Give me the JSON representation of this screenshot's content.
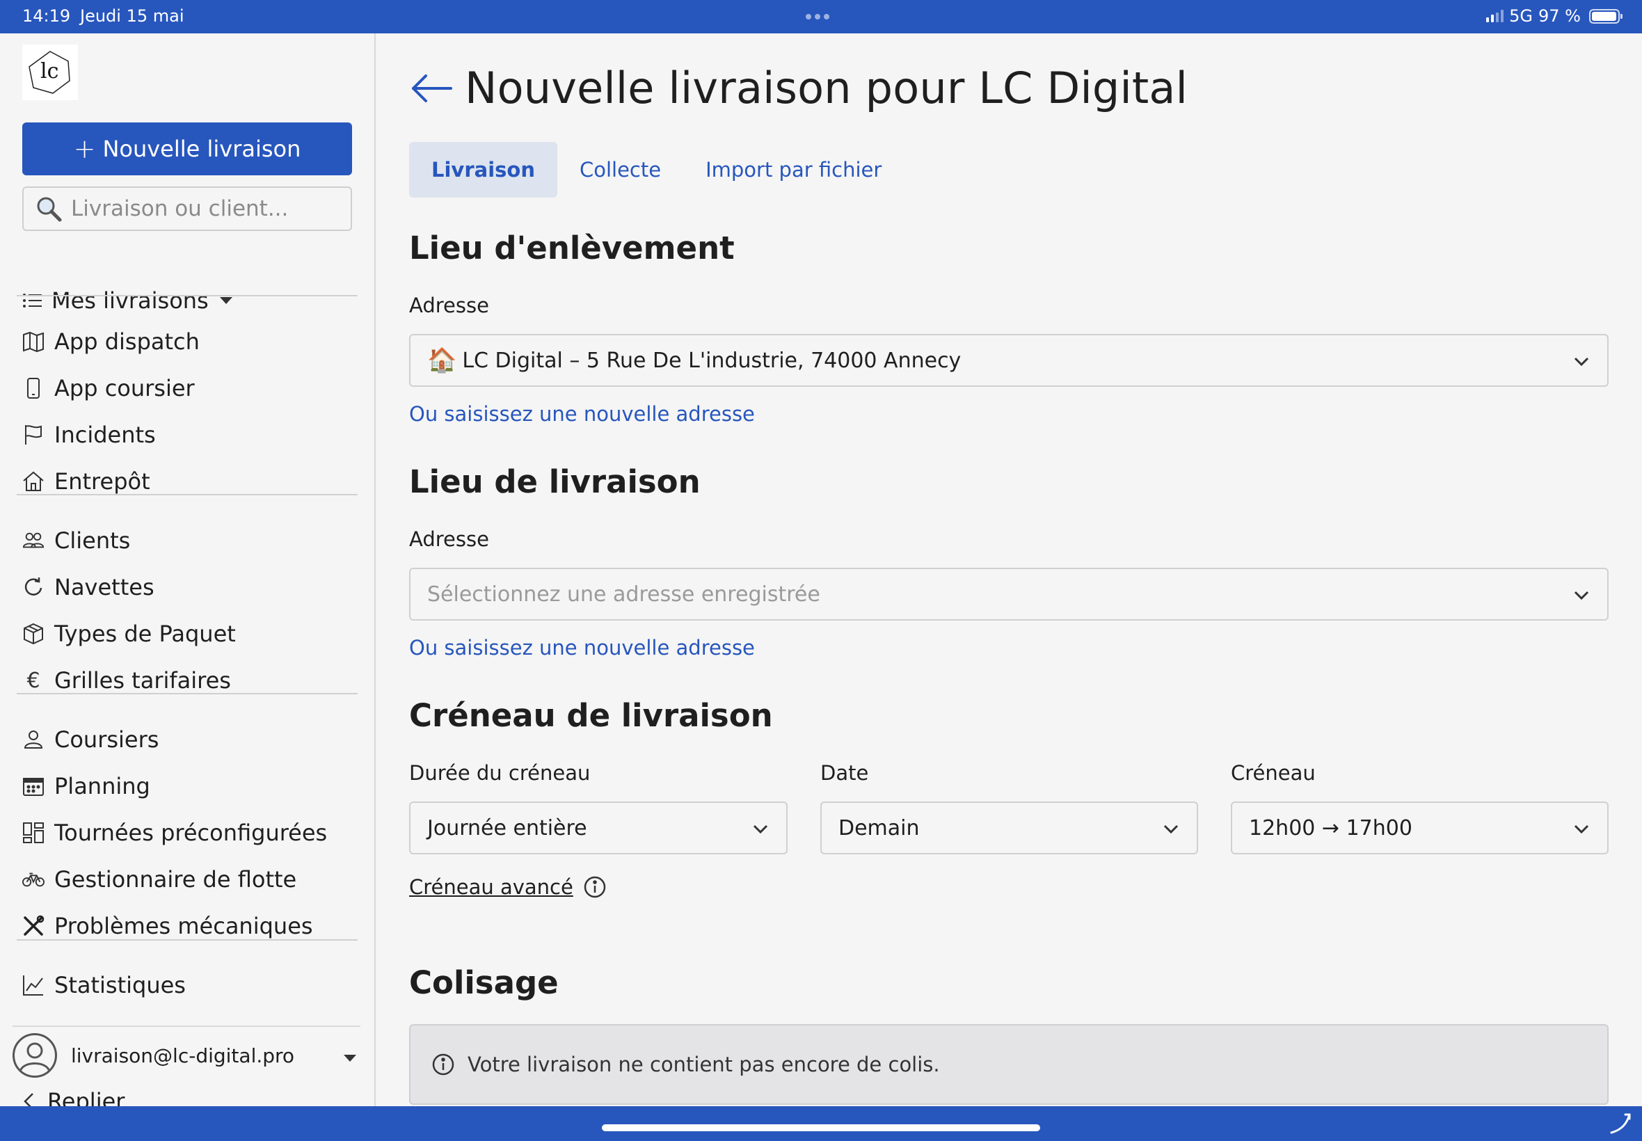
{
  "status_bar": {
    "time": "14:19",
    "date": "Jeudi 15 mai",
    "network": "5G",
    "battery": "97 %",
    "battery_level": 0.97
  },
  "sidebar": {
    "new_delivery_label": "Nouvelle livraison",
    "search_placeholder": "Livraison ou client...",
    "my_deliveries_label": "Mes livraisons",
    "groups": [
      [
        {
          "label": "App dispatch",
          "icon": "map-icon"
        },
        {
          "label": "App coursier",
          "icon": "phone-icon"
        },
        {
          "label": "Incidents",
          "icon": "flag-icon"
        },
        {
          "label": "Entrepôt",
          "icon": "house-icon"
        }
      ],
      [
        {
          "label": "Clients",
          "icon": "users-icon"
        },
        {
          "label": "Navettes",
          "icon": "refresh-icon"
        },
        {
          "label": "Types de Paquet",
          "icon": "box-icon"
        },
        {
          "label": "Grilles tarifaires",
          "icon": "euro-icon"
        }
      ],
      [
        {
          "label": "Coursiers",
          "icon": "person-icon"
        },
        {
          "label": "Planning",
          "icon": "calendar-icon"
        },
        {
          "label": "Tournées préconfigurées",
          "icon": "layout-icon"
        },
        {
          "label": "Gestionnaire de flotte",
          "icon": "bicycle-icon"
        },
        {
          "label": "Problèmes mécaniques",
          "icon": "tools-icon"
        }
      ],
      [
        {
          "label": "Statistiques",
          "icon": "chart-icon"
        }
      ]
    ],
    "user_email": "livraison@lc-digital.pro",
    "collapse_label": "Replier"
  },
  "main": {
    "title": "Nouvelle livraison pour LC Digital",
    "tabs": [
      {
        "label": "Livraison",
        "active": true
      },
      {
        "label": "Collecte",
        "active": false
      },
      {
        "label": "Import par fichier",
        "active": false
      }
    ],
    "pickup": {
      "title": "Lieu d'enlèvement",
      "address_label": "Adresse",
      "address_value": "LC Digital – 5 Rue De L'industrie, 74000 Annecy",
      "new_address_link": "Ou saisissez une nouvelle adresse"
    },
    "delivery": {
      "title": "Lieu de livraison",
      "address_label": "Adresse",
      "address_placeholder": "Sélectionnez une adresse enregistrée",
      "new_address_link": "Ou saisissez une nouvelle adresse"
    },
    "slot": {
      "title": "Créneau de livraison",
      "duration_label": "Durée du créneau",
      "duration_value": "Journée entière",
      "date_label": "Date",
      "date_value": "Demain",
      "slot_label": "Créneau",
      "slot_value": "12h00 → 17h00",
      "advanced_label": "Créneau avancé"
    },
    "packaging": {
      "title": "Colisage",
      "empty_message": "Votre livraison ne contient pas encore de colis."
    }
  },
  "colors": {
    "brand": "#2756bd",
    "background": "#f5f5f5",
    "active_tab_bg": "#dde4ef"
  }
}
